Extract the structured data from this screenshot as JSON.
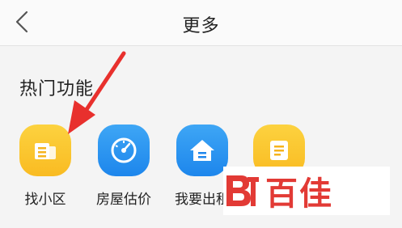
{
  "header": {
    "title": "更多"
  },
  "section": {
    "title": "热门功能"
  },
  "items": [
    {
      "label": "找小区",
      "icon": "building-icon",
      "color": "#f9bb22"
    },
    {
      "label": "房屋估价",
      "icon": "gauge-icon",
      "color": "#1d86ec"
    },
    {
      "label": "我要出租",
      "icon": "house-icon",
      "color": "#1d86ec"
    },
    {
      "label": "",
      "icon": "document-icon",
      "color": "#f9bb22"
    }
  ],
  "watermark": {
    "text": "百佳",
    "color": "#e23a35"
  },
  "annotation": {
    "arrow_color": "#e8302d"
  }
}
